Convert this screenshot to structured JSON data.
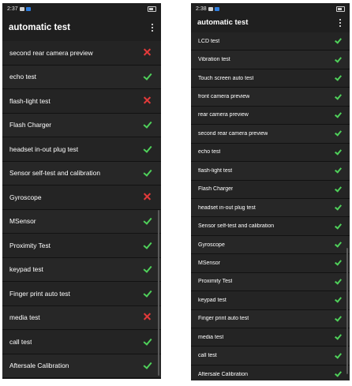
{
  "screens": [
    {
      "status": {
        "time": "2:37"
      },
      "title": "automatic test",
      "items": [
        {
          "label": "second rear camera preview",
          "status": "fail"
        },
        {
          "label": "echo test",
          "status": "pass"
        },
        {
          "label": "flash-light test",
          "status": "fail"
        },
        {
          "label": "Flash Charger",
          "status": "pass"
        },
        {
          "label": "headset in-out plug test",
          "status": "pass"
        },
        {
          "label": "Sensor self-test and calibration",
          "status": "pass"
        },
        {
          "label": "Gyroscope",
          "status": "fail"
        },
        {
          "label": "MSensor",
          "status": "pass"
        },
        {
          "label": "Proximity Test",
          "status": "pass"
        },
        {
          "label": "keypad test",
          "status": "pass"
        },
        {
          "label": "Finger print auto test",
          "status": "pass"
        },
        {
          "label": "media test",
          "status": "fail"
        },
        {
          "label": "call test",
          "status": "pass"
        },
        {
          "label": "Aftersale Calibration",
          "status": "pass"
        }
      ]
    },
    {
      "status": {
        "time": "2:38"
      },
      "title": "automatic test",
      "items": [
        {
          "label": "LCD test",
          "status": "pass"
        },
        {
          "label": "Vibration test",
          "status": "pass"
        },
        {
          "label": "Touch screen auto test",
          "status": "pass"
        },
        {
          "label": "front camera preview",
          "status": "pass"
        },
        {
          "label": "rear camera preview",
          "status": "pass"
        },
        {
          "label": "second rear camera preview",
          "status": "pass"
        },
        {
          "label": "echo test",
          "status": "pass"
        },
        {
          "label": "flash-light test",
          "status": "pass"
        },
        {
          "label": "Flash Charger",
          "status": "pass"
        },
        {
          "label": "headset in-out plug test",
          "status": "pass"
        },
        {
          "label": "Sensor self-test and calibration",
          "status": "pass"
        },
        {
          "label": "Gyroscope",
          "status": "pass"
        },
        {
          "label": "MSensor",
          "status": "pass"
        },
        {
          "label": "Proximity Test",
          "status": "pass"
        },
        {
          "label": "keypad test",
          "status": "pass"
        },
        {
          "label": "Finger print auto test",
          "status": "pass"
        },
        {
          "label": "media test",
          "status": "pass"
        },
        {
          "label": "call test",
          "status": "pass"
        },
        {
          "label": "Aftersale Calibration",
          "status": "pass"
        }
      ]
    }
  ],
  "colors": {
    "background": "#1f1f1f",
    "pass": "#4fd15a",
    "fail": "#e23a3a",
    "text": "#ffffff"
  },
  "icons": {
    "pass": "checkmark-icon",
    "fail": "cross-icon",
    "menu": "overflow-menu-icon"
  }
}
